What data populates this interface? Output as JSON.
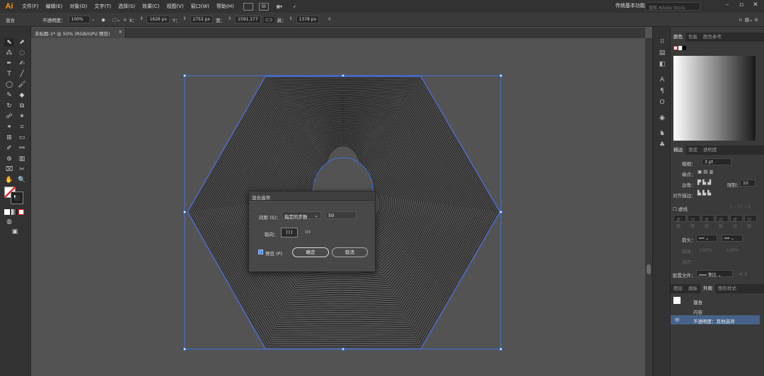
{
  "app": {
    "logo": "Ai"
  },
  "menu": [
    "文件(F)",
    "编辑(E)",
    "对象(O)",
    "文字(T)",
    "选择(S)",
    "效果(C)",
    "视图(V)",
    "窗口(W)",
    "帮助(H)"
  ],
  "menubar": {
    "br_label": "Br",
    "st_label": "St",
    "workspace": "传统基本功能",
    "stock_placeholder": "搜索 Adobe Stock"
  },
  "control": {
    "selection_type": "混合",
    "opacity_label": "不透明度：",
    "opacity_value": "100%",
    "x_label": "X：",
    "x_value": "1626 px",
    "y_label": "Y：",
    "y_value": "2752 px",
    "w_label": "宽：",
    "w_value": "1591.177",
    "h_label": "高：",
    "h_value": "1378 px"
  },
  "document_tab": {
    "title": "未标题-1* @ 50% (RGB/GPU 预览)",
    "close": "×"
  },
  "color_panel": {
    "tabs": [
      "颜色",
      "色板",
      "颜色参考"
    ],
    "active": 0
  },
  "stroke_panel": {
    "tabs": [
      "描边",
      "渐变",
      "透明度"
    ],
    "weight_label": "粗细：",
    "weight_value": "3 pt",
    "cap_label": "端点：",
    "corner_label": "边角：",
    "limit_label": "限制：",
    "limit_value": "10",
    "align_label": "对齐描边：",
    "dashed_label": "虚线",
    "dash_cells": [
      "虚线",
      "间隙",
      "虚线",
      "间隙",
      "虚线",
      "间隙"
    ],
    "arrow_label": "箭头：",
    "scale_label": "缩放：",
    "scale_value1": "100%",
    "scale_value2": "100%",
    "align2_label": "对齐：",
    "profile_label": "配置文件：",
    "profile_value": "等比"
  },
  "appearance_panel": {
    "tabs": [
      "图层",
      "画板",
      "外观",
      "图形样式"
    ],
    "active": 2,
    "title": "混合",
    "content": "内容",
    "opacity_row": "不透明度：其他选项"
  },
  "blend_dialog": {
    "title": "混合选项",
    "spacing_label": "间距 (S)：",
    "spacing_option": "指定的步数",
    "steps_value": "50",
    "orientation_label": "取向：",
    "preview_label": "预览 (P)",
    "preview_checked": true,
    "ok_label": "确定",
    "cancel_label": "取消"
  },
  "colors": {
    "accent": "#3b7bff",
    "logo": "#ff9a00",
    "canvas": "#535353"
  }
}
